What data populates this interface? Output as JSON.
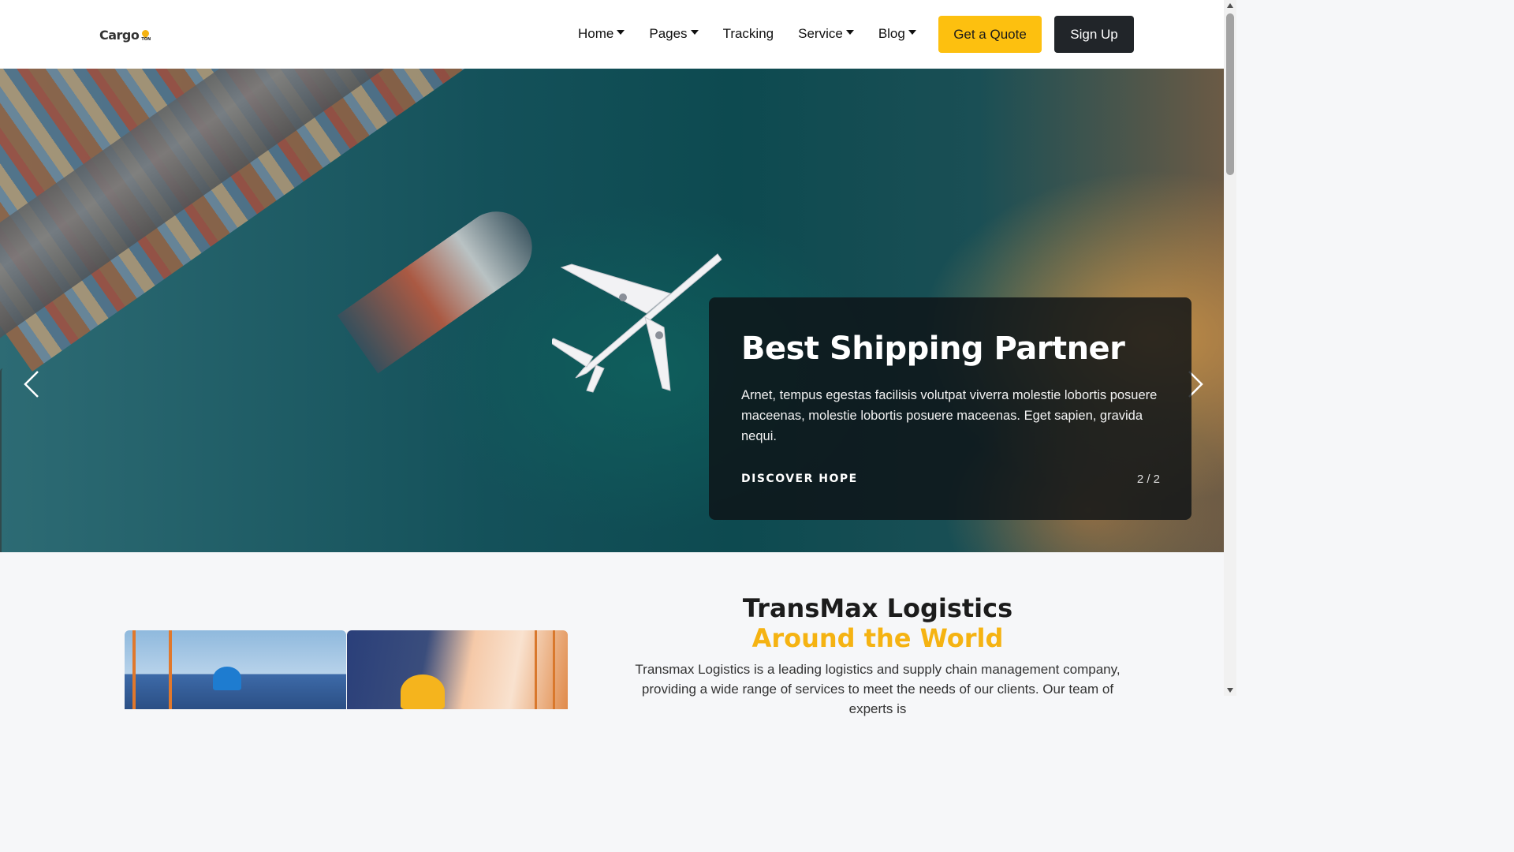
{
  "brand": {
    "name": "Cargo",
    "mark_text": "TON",
    "accent_color": "#fdc00f"
  },
  "nav": {
    "items": [
      {
        "label": "Home",
        "dropdown": true
      },
      {
        "label": "Pages",
        "dropdown": true
      },
      {
        "label": "Tracking",
        "dropdown": false
      },
      {
        "label": "Service",
        "dropdown": true
      },
      {
        "label": "Blog",
        "dropdown": true
      }
    ],
    "quote_label": "Get a Quote",
    "signup_label": "Sign Up"
  },
  "hero": {
    "title": "Best Shipping Partner",
    "text": "Arnet, tempus egestas facilisis volutpat viverra molestie lobortis posuere maceenas, molestie lobortis posuere maceenas. Eget sapien, gravida nequi.",
    "link_label": "DISCOVER HOPE",
    "counter": "2 / 2",
    "prev_icon": "chevron-left-icon",
    "next_icon": "chevron-right-icon"
  },
  "about": {
    "title": "TransMax Logistics",
    "subtitle": "Around the World",
    "text": "Transmax Logistics is a leading logistics and supply chain management company, providing a wide range of services to meet the needs of our clients. Our team of experts is"
  }
}
